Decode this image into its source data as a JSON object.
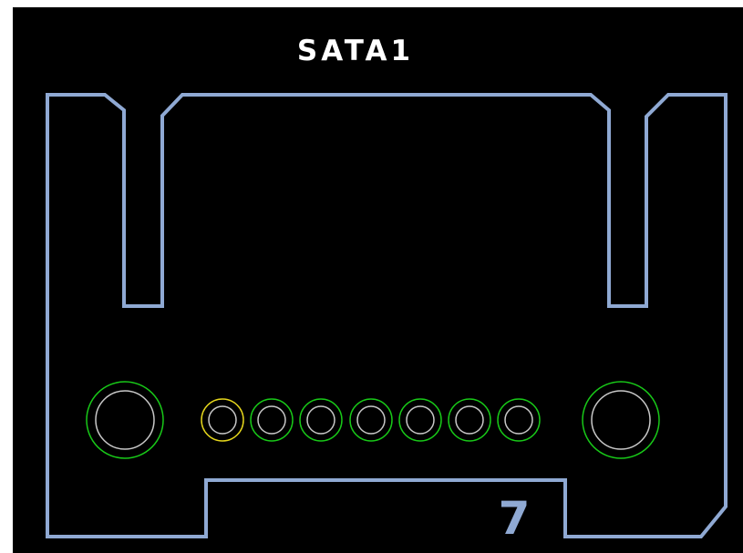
{
  "board": {
    "label": "SATA1",
    "corner_number": "7"
  },
  "colors": {
    "background": "#000000",
    "outline": "#8fa9d3",
    "silkscreen": "#ffffff",
    "pad_ring": "#18c818",
    "pad_ring_pin1": "#e5d61c",
    "drill_hole": "#c8c8c8",
    "number": "#8fa9d3"
  },
  "pads": {
    "mounting_holes": [
      "mounting-hole-left",
      "mounting-hole-right"
    ],
    "pins": [
      "1",
      "2",
      "3",
      "4",
      "5",
      "6",
      "7"
    ],
    "pin1_highlighted": true
  }
}
